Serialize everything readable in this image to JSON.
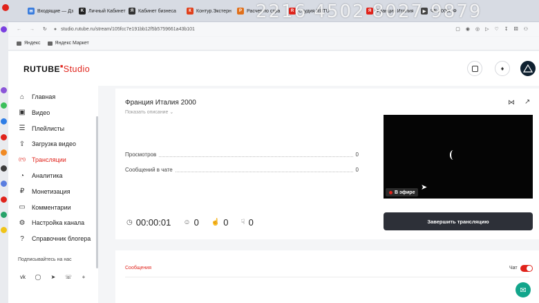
{
  "browser": {
    "tabs": [
      {
        "label": "Входящие — Дз",
        "color": "#3b7ddd",
        "glyph": "✉"
      },
      {
        "label": "Личный Кабинет",
        "color": "#222222",
        "glyph": "K"
      },
      {
        "label": "Кабинет бизнеса",
        "color": "#333333",
        "glyph": "Я"
      },
      {
        "label": "Контур.Экстерн",
        "color": "#e0401b",
        "glyph": "К"
      },
      {
        "label": "Расчет по стра",
        "color": "#e0701b",
        "glyph": "Р"
      },
      {
        "label": "Студия RUTU",
        "color": "#e0231b",
        "glyph": "R"
      },
      {
        "label": "Франция Италия",
        "color": "#e0231b",
        "glyph": "Я"
      },
      {
        "label": "ЧЕ 2000г. Ф",
        "color": "#444444",
        "glyph": "▶"
      }
    ],
    "overlay_text": "2216 4502 8027 9879",
    "url": "studio.rutube.ru/stream/105fcc7e191bb12f5b5759661a43b101",
    "bookmarks": [
      "Яндекс",
      "Яндекс Маркет"
    ]
  },
  "header": {
    "logo_main": "RUTUBE",
    "logo_sub": "Studio"
  },
  "sidebar": {
    "items": [
      {
        "label": "Главная",
        "icon": "home-icon",
        "glyph": "⌂"
      },
      {
        "label": "Видео",
        "icon": "video-icon",
        "glyph": "▣"
      },
      {
        "label": "Плейлисты",
        "icon": "list-icon",
        "glyph": "☰"
      },
      {
        "label": "Загрузка видео",
        "icon": "upload-icon",
        "glyph": "⇪"
      },
      {
        "label": "Трансляции",
        "icon": "broadcast-icon",
        "glyph": "((•))"
      },
      {
        "label": "Аналитика",
        "icon": "analytics-icon",
        "glyph": "◔"
      },
      {
        "label": "Монетизация",
        "icon": "money-icon",
        "glyph": "₽"
      },
      {
        "label": "Комментарии",
        "icon": "comments-icon",
        "glyph": "▭"
      },
      {
        "label": "Настройка канала",
        "icon": "gear-icon",
        "glyph": "⚙"
      },
      {
        "label": "Справочник блогера",
        "icon": "help-icon",
        "glyph": "?"
      }
    ],
    "active_index": 4,
    "subscribe_label": "Подписывайтесь на нас",
    "socials": [
      "vk",
      "ok",
      "telegram",
      "viber",
      "more"
    ]
  },
  "stream": {
    "title": "Франция Италия 2000",
    "show_description": "Показать описание",
    "stats": [
      {
        "label": "Просмотров",
        "value": "0"
      },
      {
        "label": "Сообщений в чате",
        "value": "0"
      }
    ],
    "timer": "00:00:01",
    "viewers": "0",
    "likes": "0",
    "dislikes": "0",
    "live_label": "В эфире",
    "end_button": "Завершить трансляцию"
  },
  "chat": {
    "messages_tab": "Сообщения",
    "chat_label": "Чат",
    "chat_enabled": true
  },
  "colors": {
    "accent": "#e0231b",
    "dark_button": "#2d3038"
  }
}
